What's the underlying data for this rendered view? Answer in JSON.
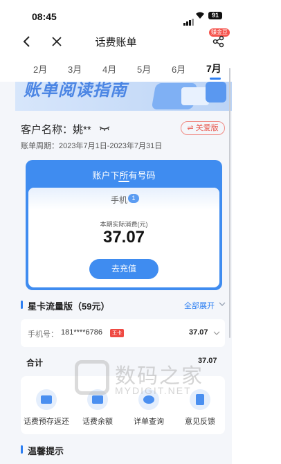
{
  "status_bar": {
    "time": "08:45",
    "battery": "91"
  },
  "nav": {
    "title": "话费账单",
    "badge": "赚金豆"
  },
  "tabs": [
    {
      "label": "2月",
      "active": false
    },
    {
      "label": "3月",
      "active": false
    },
    {
      "label": "4月",
      "active": false
    },
    {
      "label": "5月",
      "active": false
    },
    {
      "label": "6月",
      "active": false
    },
    {
      "label": "7月",
      "active": true
    }
  ],
  "banner": {
    "text": "账单阅读指南"
  },
  "customer": {
    "name_label": "客户名称：姚**",
    "care_button": "⇌ 关爱版",
    "period": "账单周期：2023年7月1日-2023年7月31日"
  },
  "account_card": {
    "title": "账户下所有号码",
    "phone_label": "手机",
    "phone_count": "1",
    "consumption_label": "本期实际消费(元)",
    "consumption_value": "37.07",
    "recharge_button": "去充值"
  },
  "plan": {
    "name": "星卡流量版（59元）",
    "expand_all": "全部展开"
  },
  "number_row": {
    "label": "手机号：",
    "number": "181****6786",
    "tag": "王卡",
    "amount": "37.07"
  },
  "total": {
    "label": "合计",
    "value": "37.07"
  },
  "shortcuts": [
    {
      "label": "话费预存返还",
      "icon": "deposit-return-icon"
    },
    {
      "label": "话费余额",
      "icon": "balance-icon"
    },
    {
      "label": "详单查询",
      "icon": "detail-query-icon"
    },
    {
      "label": "意见反馈",
      "icon": "feedback-icon"
    }
  ],
  "tips": {
    "title": "温馨提示"
  },
  "watermark": {
    "text": "数码之家",
    "sub": "MYDIGIT.NET"
  },
  "colors": {
    "accent": "#3f8cf0",
    "warn": "#ef4a43",
    "background": "#f4f6fa"
  }
}
